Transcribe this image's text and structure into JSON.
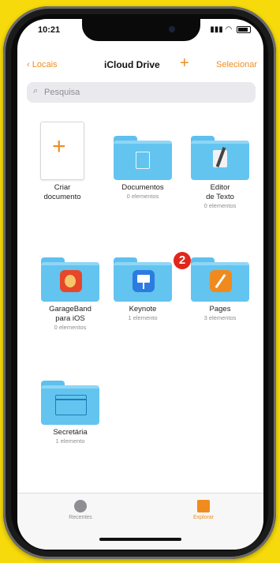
{
  "status": {
    "time": "10:21"
  },
  "nav": {
    "back_label": "Locais",
    "title": "iCloud Drive",
    "add_label": "+",
    "select_label": "Selecionar"
  },
  "search": {
    "placeholder": "Pesquisa"
  },
  "items": [
    {
      "name": "Criar\ndocumento",
      "count": ""
    },
    {
      "name": "Documentos",
      "count": "0 elementos"
    },
    {
      "name": "Editor\nde Texto",
      "count": "0 elementos"
    },
    {
      "name": "GarageBand\npara iOS",
      "count": "0 elementos"
    },
    {
      "name": "Keynote",
      "count": "1 elemento"
    },
    {
      "name": "Pages",
      "count": "3 elementos"
    },
    {
      "name": "Secretária",
      "count": "1 elemento"
    }
  ],
  "badge": {
    "number": "2"
  },
  "tabbar": {
    "recents_label": "Recentes",
    "browse_label": "Explorar"
  },
  "colors": {
    "accent": "#f08c1e",
    "folder": "#63c4f0",
    "badge": "#e1261c",
    "background": "#f6da0b"
  }
}
